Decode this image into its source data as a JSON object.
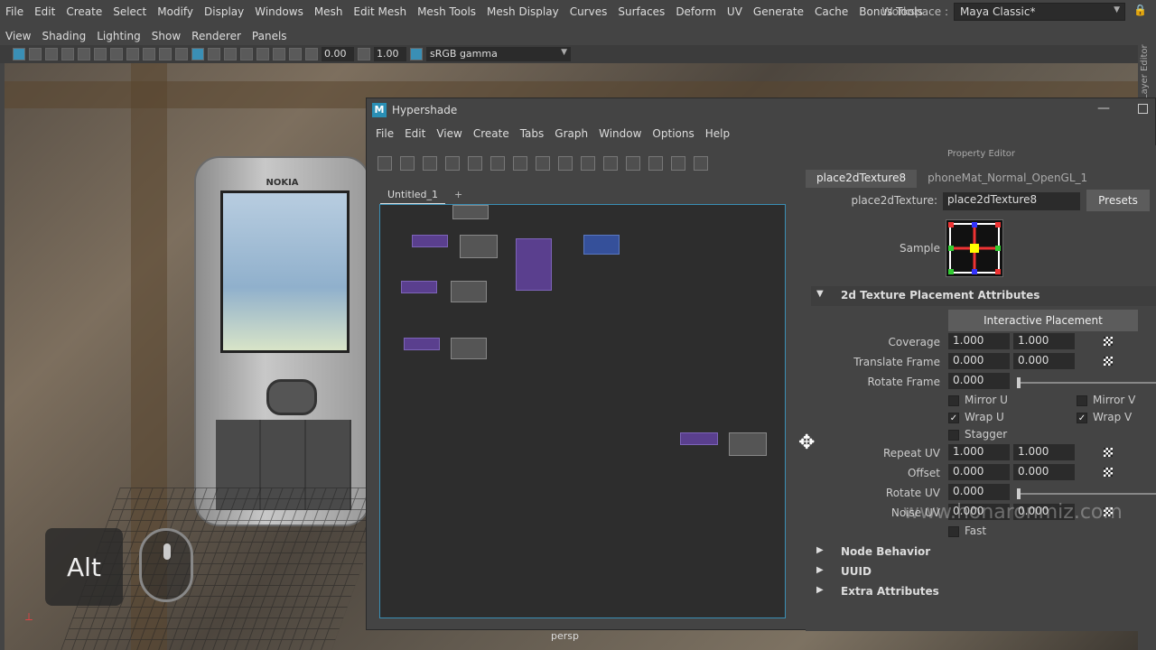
{
  "main_menu": [
    "File",
    "Edit",
    "Create",
    "Select",
    "Modify",
    "Display",
    "Windows",
    "Mesh",
    "Edit Mesh",
    "Mesh Tools",
    "Mesh Display",
    "Curves",
    "Surfaces",
    "Deform",
    "UV",
    "Generate",
    "Cache",
    "Bonus Tools"
  ],
  "workspace": {
    "label": "Workspace :",
    "value": "Maya Classic*"
  },
  "side_tab": "Layer Editor",
  "panel_menu": [
    "View",
    "Shading",
    "Lighting",
    "Show",
    "Renderer",
    "Panels"
  ],
  "panel_toolbar": {
    "exposure": "0.00",
    "gamma": "1.00",
    "color_space": "sRGB gamma"
  },
  "viewport": {
    "camera": "persp",
    "alt_label": "Alt",
    "phone_brand": "NOKIA"
  },
  "hypershade": {
    "title": "Hypershade",
    "menu": [
      "File",
      "Edit",
      "View",
      "Create",
      "Tabs",
      "Graph",
      "Window",
      "Options",
      "Help"
    ],
    "graph_tab": "Untitled_1",
    "add_tab": "+"
  },
  "property_editor": {
    "title": "Property Editor",
    "tabs": [
      "place2dTexture8",
      "phoneMat_Normal_OpenGL_1"
    ],
    "node_type_label": "place2dTexture:",
    "node_name": "place2dTexture8",
    "presets": "Presets",
    "sample_label": "Sample",
    "section_main": "2d Texture Placement Attributes",
    "interactive_placement": "Interactive Placement",
    "coverage": {
      "label": "Coverage",
      "u": "1.000",
      "v": "1.000"
    },
    "translate_frame": {
      "label": "Translate Frame",
      "u": "0.000",
      "v": "0.000"
    },
    "rotate_frame": {
      "label": "Rotate Frame",
      "value": "0.000"
    },
    "mirror_u": "Mirror U",
    "mirror_v": "Mirror V",
    "wrap_u": "Wrap U",
    "wrap_v": "Wrap V",
    "stagger": "Stagger",
    "repeat_uv": {
      "label": "Repeat UV",
      "u": "1.000",
      "v": "1.000"
    },
    "offset": {
      "label": "Offset",
      "u": "0.000",
      "v": "0.000"
    },
    "rotate_uv": {
      "label": "Rotate UV",
      "value": "0.000"
    },
    "noise_uv": {
      "label": "Noise UV",
      "u": "0.000",
      "v": "0.000"
    },
    "fast": "Fast",
    "sections_collapsed": [
      "Node Behavior",
      "UUID",
      "Extra Attributes"
    ]
  },
  "watermark": "www.honaronmiz.com"
}
